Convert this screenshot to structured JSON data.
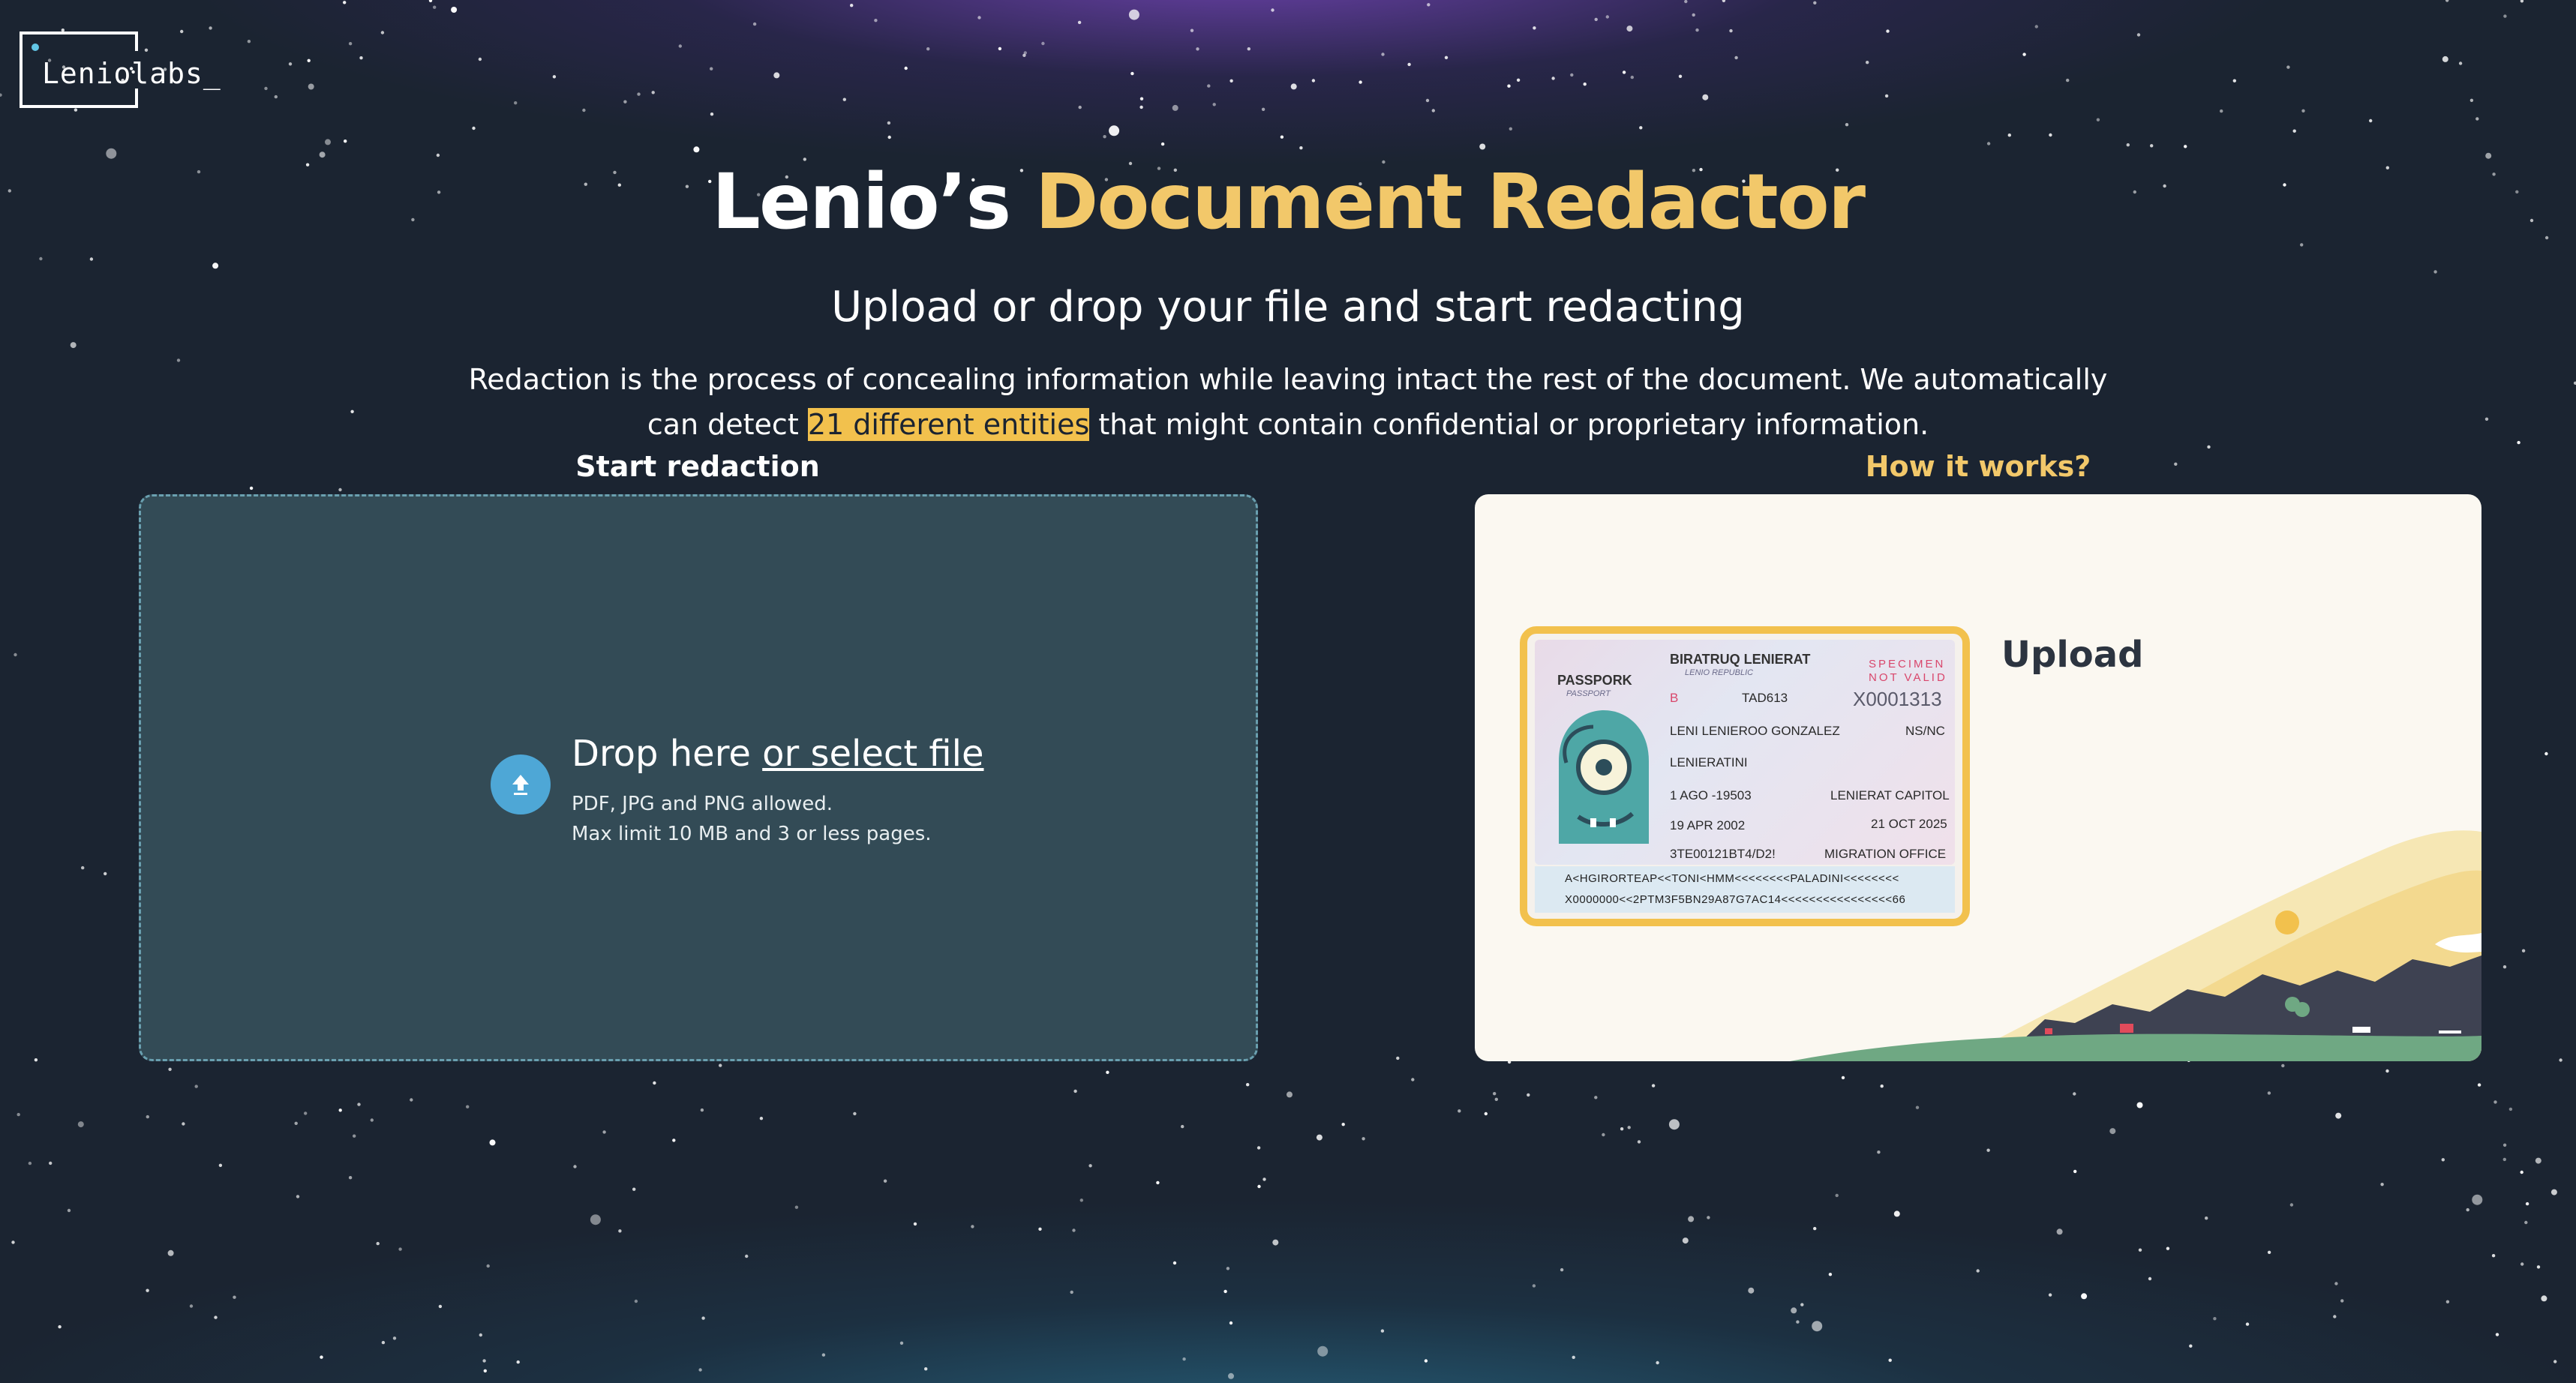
{
  "logo": {
    "text": "Leniolabs_"
  },
  "hero": {
    "title_part1": "Lenio’s ",
    "title_part2": "Document Redactor",
    "subtitle": "Upload or drop your file and start redacting",
    "desc_before": "Redaction is the process of concealing information while leaving intact the rest of the document. We automatically can detect ",
    "desc_highlight": "21 different entities",
    "desc_after": " that might contain confidential or proprietary information."
  },
  "left_panel": {
    "label": "Start redaction",
    "drop_text": "Drop here ",
    "drop_link": "or select file",
    "hint_line1": "PDF, JPG and PNG allowed.",
    "hint_line2": "Max limit 10 MB and 3 or less pages."
  },
  "right_panel": {
    "label": "How it works?",
    "step_title": "Upload",
    "passport": {
      "country": "BIRATRUQ LENIERAT",
      "country_sub": "LENIO REPUBLIC",
      "doc_label": "PASSPORK",
      "doc_label_sub": "PASSPORT",
      "specimen": "SPECIMEN",
      "not_valid": "NOT VALID",
      "doc_type": "B",
      "code": "TAD613",
      "number": "X0001313",
      "name": "LENI LENIEROO GONZALEZ",
      "sex": "NS/NC",
      "nationality": "LENIERATINI",
      "birth": "1 AGO -19503",
      "birth_place": "LENIERAT CAPITOL",
      "issue_date": "19 APR 2002",
      "expiry_date": "21 OCT 2025",
      "personal_no": "3TE00121BT4/D2!",
      "authority": "MIGRATION OFFICE",
      "mrz_line1": "A<HGIRORTEAP<<TONI<HMM<<<<<<<<PALADINI<<<<<<<<",
      "mrz_line2": "X0000000<<2PTM3F5BN29A87G7AC14<<<<<<<<<<<<<<<<66"
    }
  },
  "colors": {
    "background": "#1b2431",
    "accent": "#f2c86a",
    "highlight": "#f2c14d",
    "dropzone": "#334b56",
    "upload_icon": "#4ea7d6"
  },
  "icons": {
    "upload": "upload-arrow-icon"
  }
}
